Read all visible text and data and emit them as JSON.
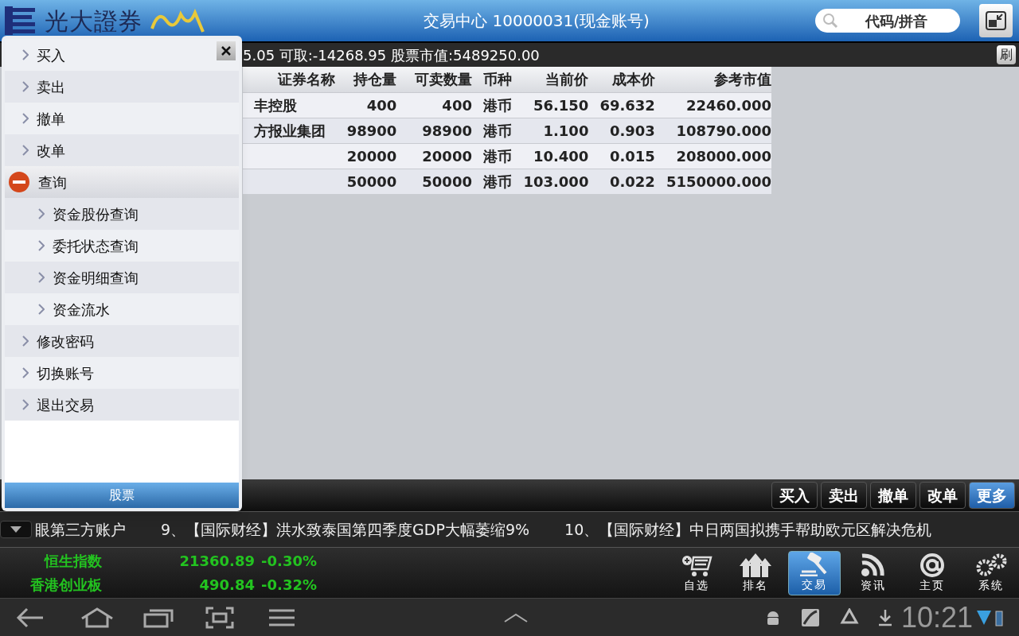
{
  "header": {
    "brand": "光大證券",
    "title": "交易中心 10000031(现金账号)",
    "search": {
      "placeholder": "代码/拼音"
    }
  },
  "info_bar": {
    "text": "5.05 可取:-14268.95 股票市值:5489250.00",
    "refresh_button": "刷"
  },
  "table": {
    "columns": [
      "证券名称",
      "持仓量",
      "可卖数量",
      "币种",
      "当前价",
      "成本价",
      "参考市值"
    ],
    "rows": [
      [
        "丰控股",
        "400",
        "400",
        "港币",
        "56.150",
        "69.632",
        "22460.000"
      ],
      [
        "方报业集团",
        "98900",
        "98900",
        "港币",
        "1.100",
        "0.903",
        "108790.000"
      ],
      [
        "",
        "20000",
        "20000",
        "港币",
        "10.400",
        "0.015",
        "208000.000"
      ],
      [
        "",
        "50000",
        "50000",
        "港币",
        "103.000",
        "0.022",
        "5150000.000"
      ]
    ]
  },
  "menu": {
    "items": [
      {
        "label": "买入",
        "expanded": false
      },
      {
        "label": "卖出",
        "expanded": false
      },
      {
        "label": "撤单",
        "expanded": false
      },
      {
        "label": "改单",
        "expanded": false
      },
      {
        "label": "查询",
        "expanded": true,
        "children": [
          {
            "label": "资金股份查询"
          },
          {
            "label": "委托状态查询"
          },
          {
            "label": "资金明细查询"
          },
          {
            "label": "资金流水"
          }
        ]
      },
      {
        "label": "修改密码",
        "expanded": false
      },
      {
        "label": "切换账号",
        "expanded": false
      },
      {
        "label": "退出交易",
        "expanded": false
      }
    ],
    "footer_tab": "股票"
  },
  "toolbar": [
    {
      "label": "买入",
      "selected": false
    },
    {
      "label": "卖出",
      "selected": false
    },
    {
      "label": "撤单",
      "selected": false
    },
    {
      "label": "改单",
      "selected": false
    },
    {
      "label": "更多",
      "selected": true
    }
  ],
  "ticker": [
    "眼第三方账户",
    "9、【国际财经】洪水致泰国第四季度GDP大幅萎缩9%",
    "10、【国际财经】中日两国拟携手帮助欧元区解决危机"
  ],
  "indices": [
    {
      "name": "恒生指数",
      "value": "21360.89",
      "change": "-0.30%"
    },
    {
      "name": "香港创业板",
      "value": "490.84",
      "change": "-0.32%"
    }
  ],
  "nav": [
    {
      "kind": "cart",
      "label": "自选",
      "selected": false
    },
    {
      "kind": "ranking",
      "label": "排名",
      "selected": false
    },
    {
      "kind": "trade",
      "label": "交易",
      "selected": true
    },
    {
      "kind": "news",
      "label": "资讯",
      "selected": false
    },
    {
      "kind": "home",
      "label": "主页",
      "selected": false
    },
    {
      "kind": "system",
      "label": "系统",
      "selected": false
    }
  ],
  "system_bar": {
    "time": "10:21"
  }
}
